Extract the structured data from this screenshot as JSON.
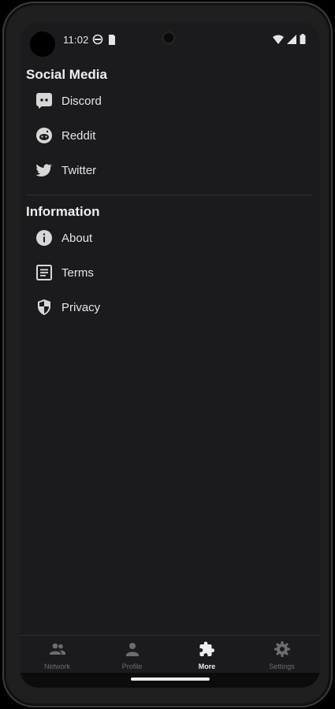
{
  "status_bar": {
    "time": "11:02"
  },
  "sections": [
    {
      "title": "Social Media",
      "items": [
        {
          "label": "Discord",
          "icon": "discord-icon"
        },
        {
          "label": "Reddit",
          "icon": "reddit-icon"
        },
        {
          "label": "Twitter",
          "icon": "twitter-icon"
        }
      ]
    },
    {
      "title": "Information",
      "items": [
        {
          "label": "About",
          "icon": "info-icon"
        },
        {
          "label": "Terms",
          "icon": "document-icon"
        },
        {
          "label": "Privacy",
          "icon": "shield-icon"
        }
      ]
    }
  ],
  "bottom_nav": [
    {
      "label": "Network",
      "icon": "people-icon",
      "active": false
    },
    {
      "label": "Profile",
      "icon": "person-icon",
      "active": false
    },
    {
      "label": "More",
      "icon": "puzzle-icon",
      "active": true
    },
    {
      "label": "Settings",
      "icon": "gear-icon",
      "active": false
    }
  ],
  "colors": {
    "background": "#1b1b1d",
    "text": "#e4e4e4",
    "inactive": "#6d6d70",
    "active": "#ededed"
  }
}
